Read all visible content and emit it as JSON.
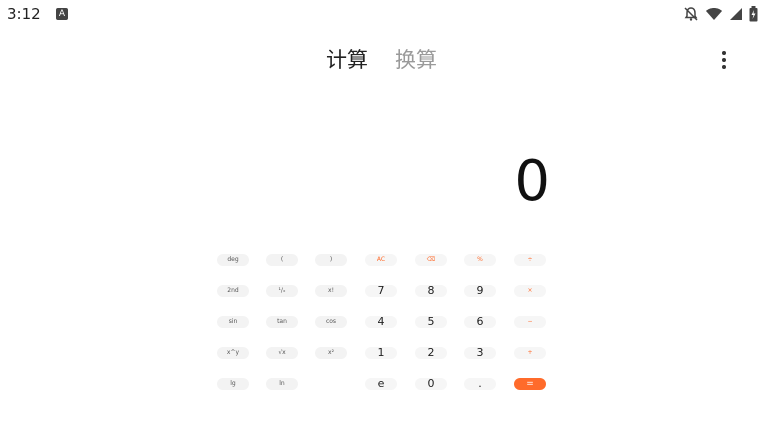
{
  "status_bar": {
    "time": "3:12",
    "app_badge": "A",
    "icons": [
      "bell-off-icon",
      "wifi-icon",
      "signal-icon",
      "battery-icon"
    ]
  },
  "header": {
    "tabs": [
      {
        "label": "计算",
        "active": true
      },
      {
        "label": "换算",
        "active": false
      }
    ],
    "menu_icon": "more-vert-icon"
  },
  "display": {
    "value": "0"
  },
  "keypad": {
    "accent_color": "#ff6b2b",
    "row1": [
      "deg",
      "(",
      ")",
      "AC",
      "⌫",
      "%",
      "÷"
    ],
    "row2": [
      "2nd",
      "¹/ₓ",
      "x!",
      "7",
      "8",
      "9",
      "×"
    ],
    "row3": [
      "sin",
      "tan",
      "cos",
      "4",
      "5",
      "6",
      "−"
    ],
    "row4": [
      "x^y",
      "√x",
      "x²",
      "1",
      "2",
      "3",
      "+"
    ],
    "row5": [
      "lg",
      "ln",
      "",
      "e",
      "0",
      ".",
      "="
    ]
  }
}
